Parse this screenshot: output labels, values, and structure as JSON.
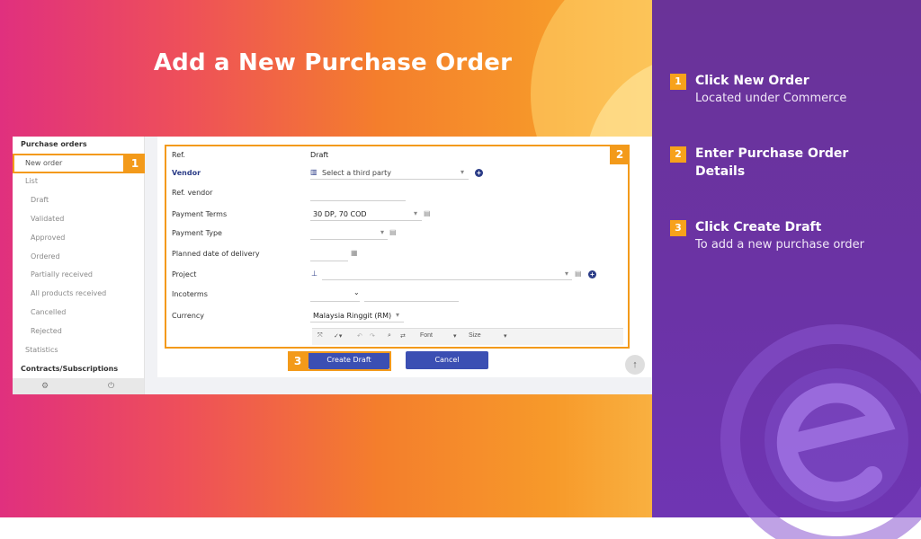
{
  "slide": {
    "title": "Add a New Purchase Order",
    "colors": {
      "accent": "#f39a1a",
      "button": "#3b4fb3",
      "purple": "#6b33a6"
    }
  },
  "sidebar": {
    "header": "Purchase orders",
    "items": [
      {
        "label": "New order"
      },
      {
        "label": "List"
      },
      {
        "label": "Draft"
      },
      {
        "label": "Validated"
      },
      {
        "label": "Approved"
      },
      {
        "label": "Ordered"
      },
      {
        "label": "Partially received"
      },
      {
        "label": "All products received"
      },
      {
        "label": "Cancelled"
      },
      {
        "label": "Rejected"
      },
      {
        "label": "Statistics"
      }
    ],
    "section2": "Contracts/Subscriptions",
    "bottom_icons": [
      "gear-icon",
      "power-icon"
    ]
  },
  "form": {
    "ref_label": "Ref.",
    "ref_value": "Draft",
    "vendor_label": "Vendor",
    "vendor_placeholder": "Select a third party",
    "ref_vendor_label": "Ref. vendor",
    "payment_terms_label": "Payment Terms",
    "payment_terms_value": "30 DP, 70 COD",
    "payment_type_label": "Payment Type",
    "planned_date_label": "Planned date of delivery",
    "project_label": "Project",
    "incoterms_label": "Incoterms",
    "currency_label": "Currency",
    "currency_value": "Malaysia Ringgit (RM)",
    "editor_font": "Font",
    "editor_size": "Size"
  },
  "buttons": {
    "create": "Create Draft",
    "cancel": "Cancel"
  },
  "markers": [
    "1",
    "2",
    "3"
  ],
  "steps": [
    {
      "num": "1",
      "title": "Click New Order",
      "sub": "Located under Commerce"
    },
    {
      "num": "2",
      "title": "Enter Purchase Order Details",
      "sub": ""
    },
    {
      "num": "3",
      "title": "Click Create Draft",
      "sub": "To add a new purchase order"
    }
  ]
}
